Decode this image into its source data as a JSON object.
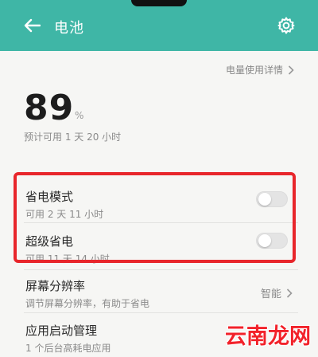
{
  "header": {
    "title": "电池",
    "back_icon": "back-arrow-icon",
    "settings_icon": "gear-icon"
  },
  "usage_detail_label": "电量使用详情",
  "battery": {
    "percent": "89",
    "percent_sign": "%",
    "estimate": "预计可用 1 天 20 小时"
  },
  "modes": [
    {
      "title": "省电模式",
      "subtitle": "可用 2 天 11 小时",
      "enabled": false
    },
    {
      "title": "超级省电",
      "subtitle": "可用 11 天 14 小时",
      "enabled": false
    }
  ],
  "resolution": {
    "title": "屏幕分辨率",
    "subtitle": "调节屏幕分辨率，有助于省电",
    "value": "智能"
  },
  "startup": {
    "title": "应用启动管理",
    "subtitle": "1 个后台高耗电应用"
  },
  "watermark": "云南龙网",
  "colors": {
    "header": "#3fb6a6",
    "highlight": "#e8262b",
    "watermark": "#f2222a"
  }
}
